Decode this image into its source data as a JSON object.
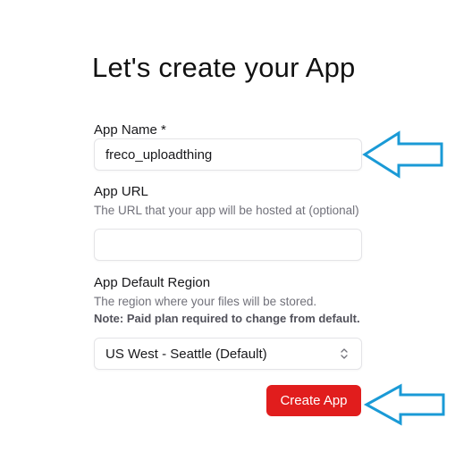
{
  "title": "Let's create your App",
  "app_name": {
    "label": "App Name *",
    "value": "freco_uploadthing"
  },
  "app_url": {
    "label": "App URL",
    "hint": "The URL that your app will be hosted at (optional)",
    "value": ""
  },
  "region": {
    "label": "App Default Region",
    "hint": "The region where your files will be stored.",
    "note": "Note: Paid plan required to change from default.",
    "selected": "US West - Seattle (Default)"
  },
  "submit": {
    "label": "Create App"
  },
  "colors": {
    "button": "#e11d1d",
    "annotation_arrow": "#1a9ad6"
  },
  "icons": {
    "select": "chevron-up-down-icon",
    "annotation": "left-arrow-annotation-icon"
  }
}
